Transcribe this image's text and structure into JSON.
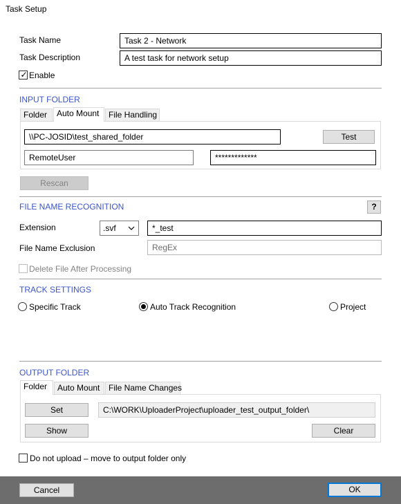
{
  "window": {
    "title": "Task Setup"
  },
  "task": {
    "name_label": "Task Name",
    "name_value": "Task 2 - Network",
    "desc_label": "Task Description",
    "desc_value": "A test task for network setup",
    "enable_label": "Enable",
    "enable_checked": "✓"
  },
  "input_folder": {
    "section": "INPUT FOLDER",
    "tabs": [
      "Folder",
      "Auto Mount",
      "File Handling"
    ],
    "active_tab": "Auto Mount",
    "path_value": "\\\\PC-JOSID\\test_shared_folder",
    "test_button": "Test",
    "user_value": "RemoteUser",
    "password_value": "*************",
    "rescan_button": "Rescan"
  },
  "recognition": {
    "section": "FILE NAME RECOGNITION",
    "help_button": "?",
    "extension_label": "Extension",
    "extension_selected": ".svf",
    "extension_pattern": "*_test",
    "exclusion_label": "File Name Exclusion",
    "exclusion_placeholder": "RegEx",
    "delete_label": "Delete File After Processing"
  },
  "track": {
    "section": "TRACK SETTINGS",
    "options": [
      "Specific Track",
      "Auto Track Recognition",
      "Project"
    ],
    "selected": "Auto Track Recognition"
  },
  "output_folder": {
    "section": "OUTPUT FOLDER",
    "tabs": [
      "Folder",
      "Auto Mount",
      "File Name Changes"
    ],
    "active_tab": "Folder",
    "set_button": "Set",
    "path_value": "C:\\WORK\\UploaderProject\\uploader_test_output_folder\\",
    "show_button": "Show",
    "clear_button": "Clear"
  },
  "no_upload_label": "Do not upload – move to output folder only",
  "footer": {
    "cancel_button": "Cancel",
    "ok_button": "OK"
  },
  "colors": {
    "section_heading": "#3c55c8",
    "footer_bg": "#6d6d6d",
    "focus_border": "#0078d7"
  }
}
